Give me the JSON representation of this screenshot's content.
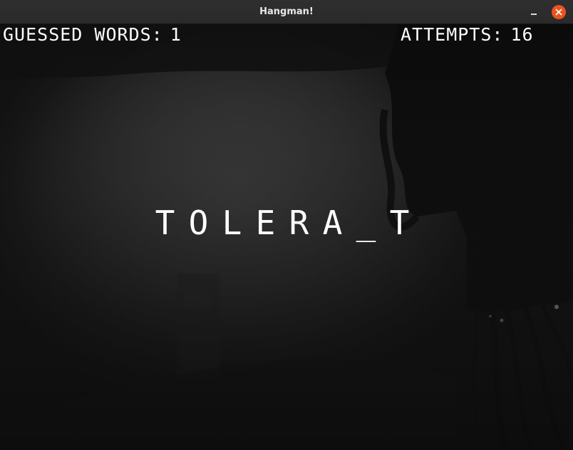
{
  "window": {
    "title": "Hangman!"
  },
  "hud": {
    "guessed_label": "GUESSED WORDS:",
    "guessed_value": "1",
    "attempts_label": "ATTEMPTS:",
    "attempts_value": "16"
  },
  "word": {
    "letters": [
      "T",
      "O",
      "L",
      "E",
      "R",
      "A",
      "_",
      "T"
    ]
  },
  "icons": {
    "minimize": "minimize-icon",
    "close": "close-icon"
  },
  "colors": {
    "close_button": "#e95420",
    "titlebar": "#2c2c2c",
    "text": "#ffffff"
  }
}
